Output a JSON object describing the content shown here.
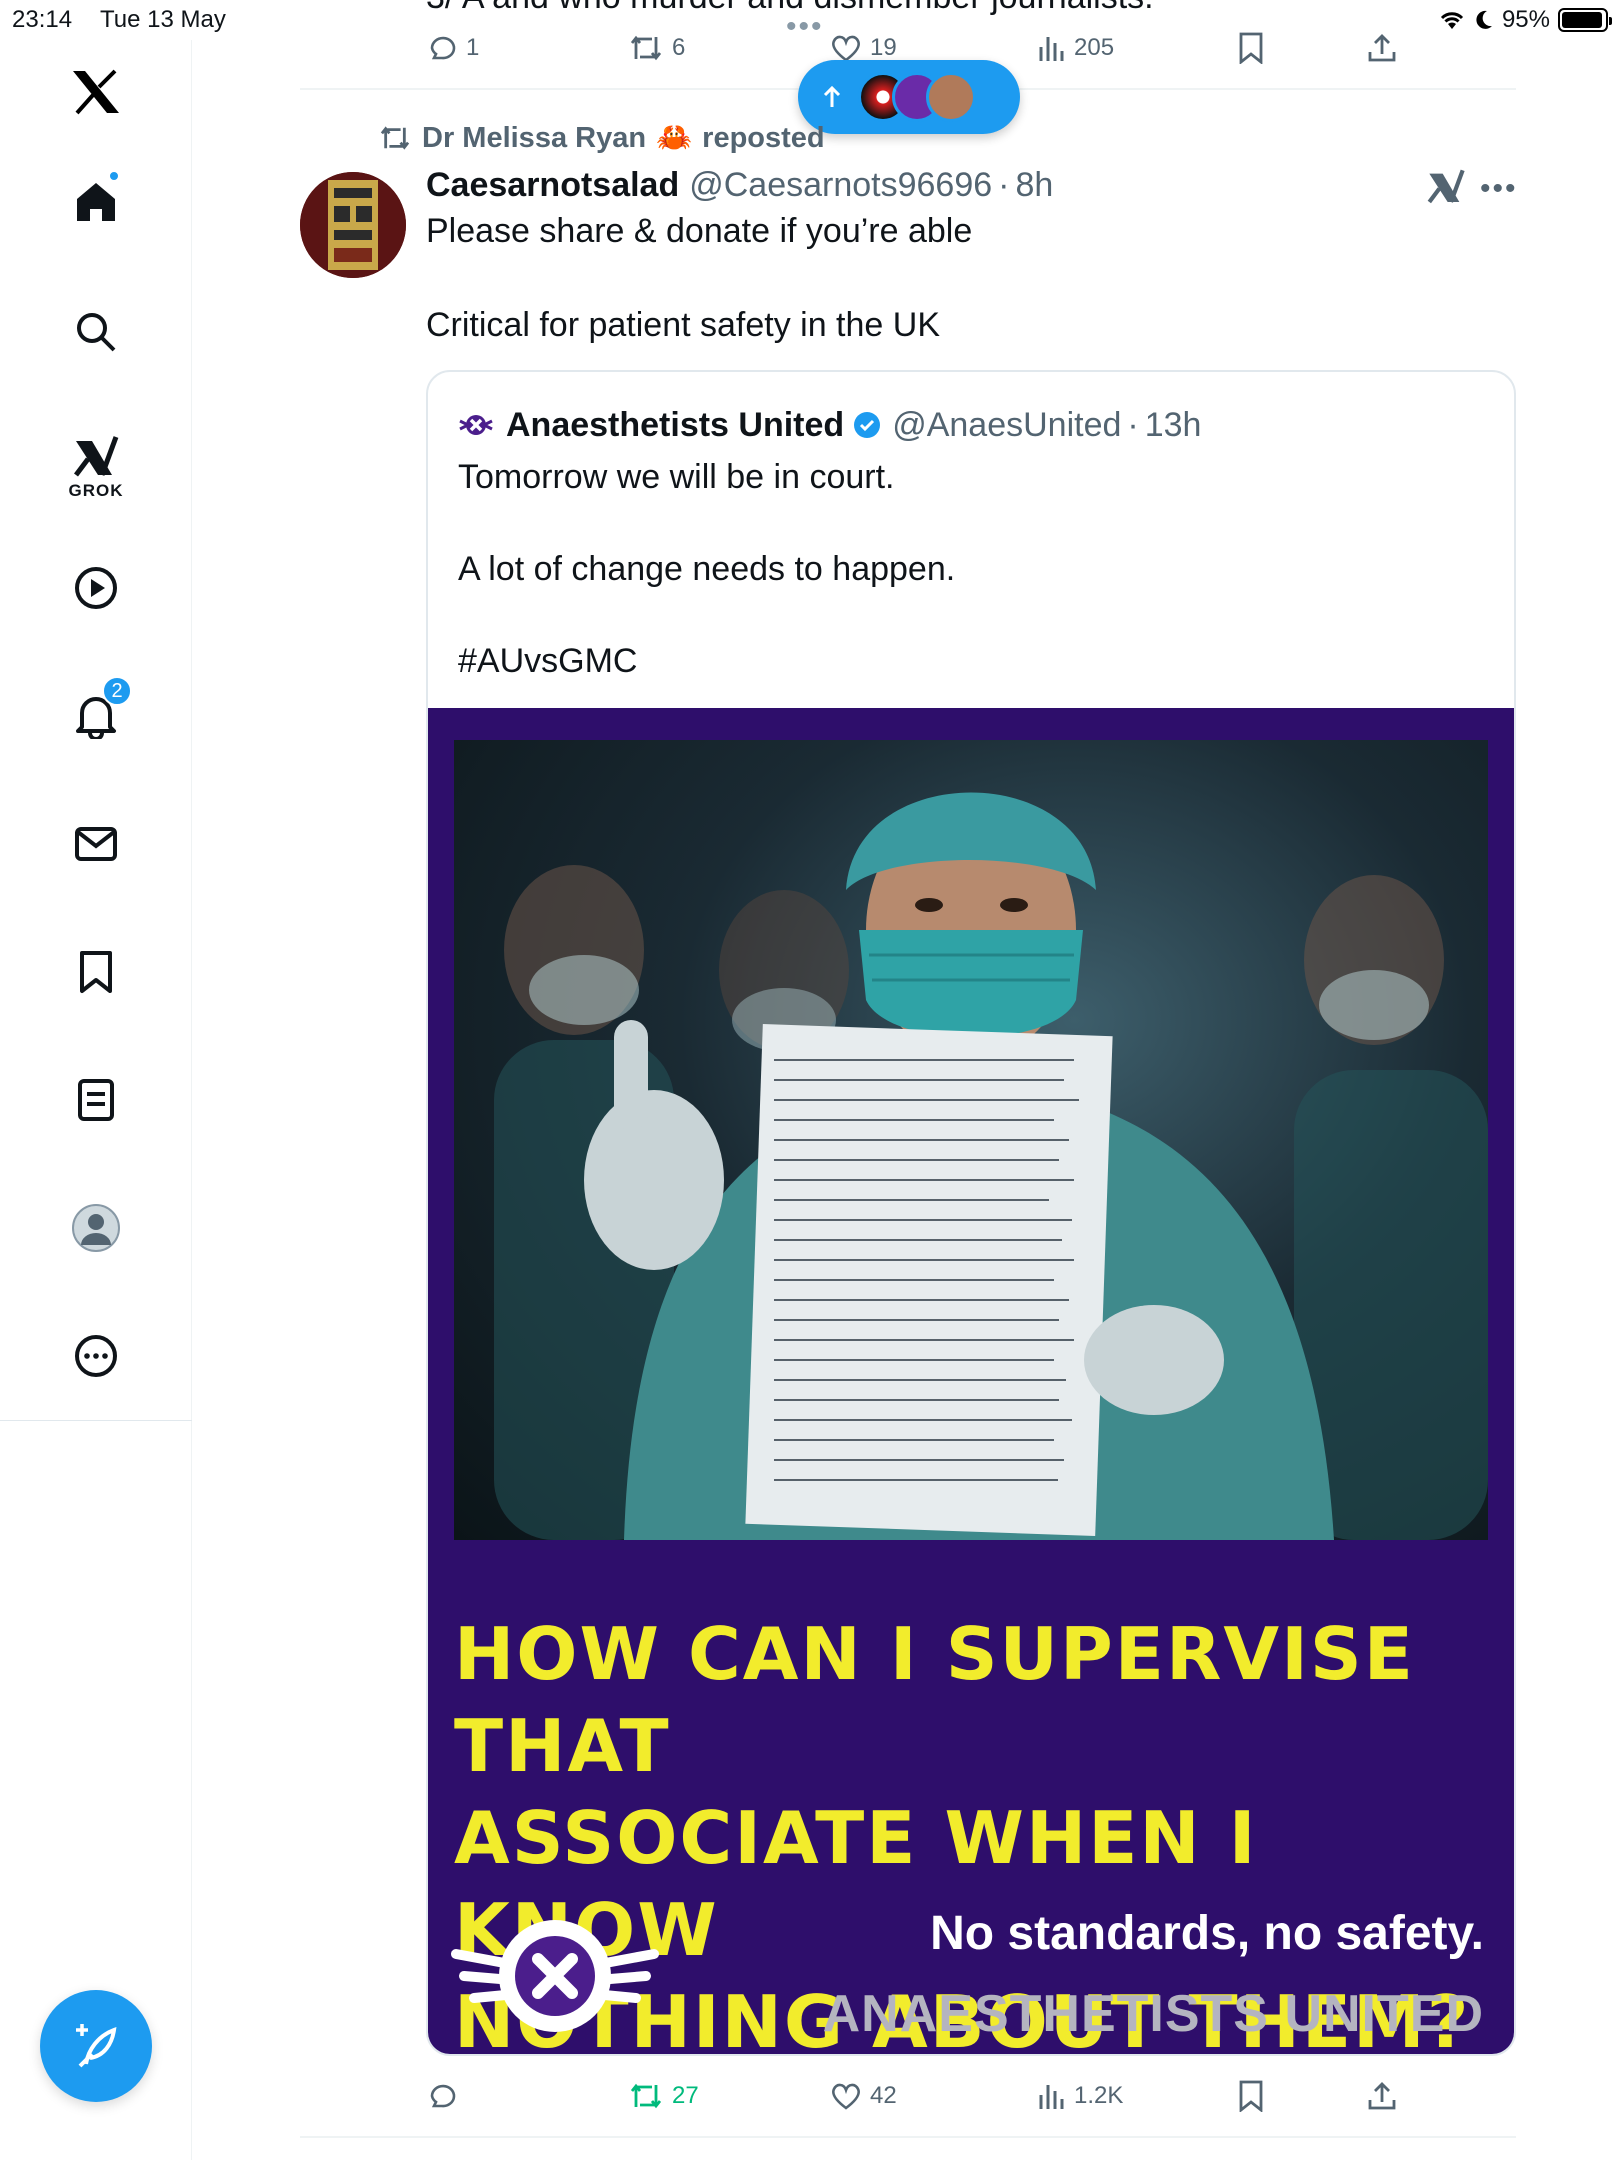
{
  "status_bar": {
    "time": "23:14",
    "date": "Tue 13 May",
    "battery": "95%"
  },
  "nav": {
    "grok_label": "GROK",
    "notification_count": "2"
  },
  "prev_post": {
    "clipped_text": "3/ A and who murder and dismember journalists.",
    "replies": "1",
    "reposts": "6",
    "likes": "19",
    "views": "205"
  },
  "repost": {
    "by": "Dr Melissa Ryan",
    "by_emoji": "🦀",
    "label": "reposted"
  },
  "post": {
    "author_name": "Caesarnotsalad",
    "handle": "@Caesarnots96696",
    "separator": "·",
    "time": "8h",
    "text_line1": "Please share & donate if you’re able",
    "text_line2": "Critical for patient safety in the UK",
    "replies": "",
    "reposts": "27",
    "likes": "42",
    "views": "1.2K"
  },
  "quote": {
    "author_name": "Anaesthetists United",
    "handle": "@AnaesUnited",
    "separator": "·",
    "time": "13h",
    "text_line1": "Tomorrow we will be in court.",
    "text_line2": "A lot of change needs to happen.",
    "text_line3": "#AUvsGMC"
  },
  "poster": {
    "headline_line1": "HOW CAN I SUPERVISE THAT",
    "headline_line2": "ASSOCIATE WHEN I KNOW",
    "headline_line3": "NOTHING ABOUT THEM?",
    "slogan": "No standards,  no safety.",
    "org_name": "ANAESTHETISTS UNITED"
  },
  "colors": {
    "accent": "#1d9bf0",
    "repost_active": "#00ba7c",
    "poster_bg": "#2e0e6b",
    "poster_headline": "#f2ec2c"
  }
}
